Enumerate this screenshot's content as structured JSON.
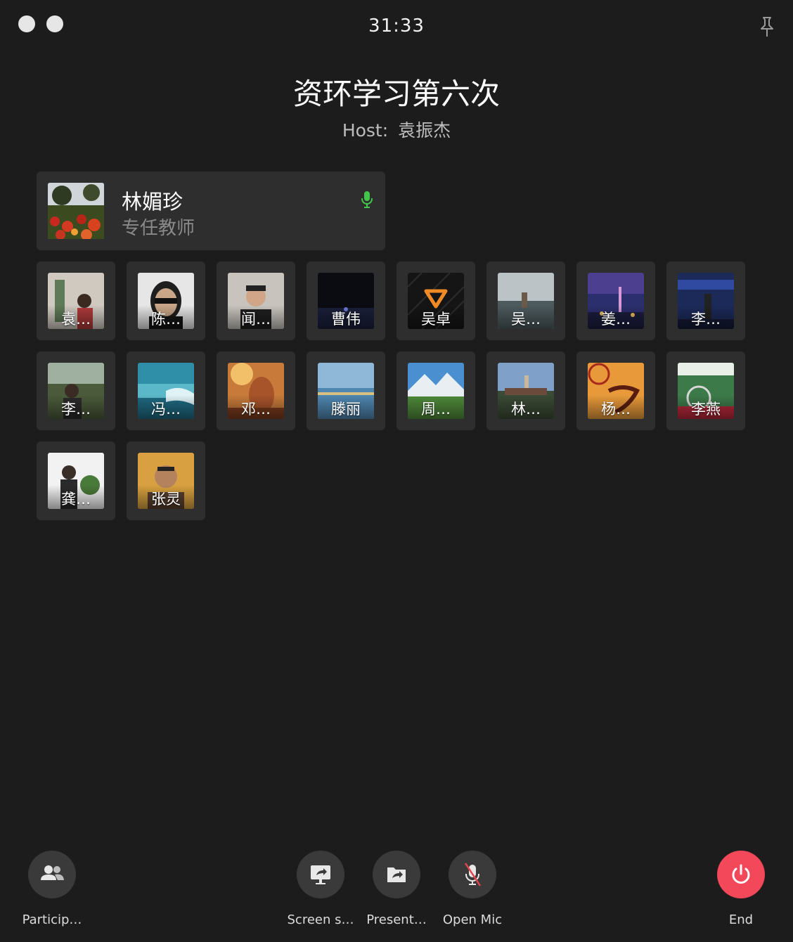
{
  "window": {
    "timer": "31:33"
  },
  "meeting": {
    "title": "资环学习第六次",
    "host_label": "Host:",
    "host_name": "袁振杰"
  },
  "speaker": {
    "name": "林媚珍",
    "role": "专任教师",
    "mic_color": "#43c74b"
  },
  "participants": [
    {
      "label": "袁…"
    },
    {
      "label": "陈…"
    },
    {
      "label": "闻…"
    },
    {
      "label": "曹伟"
    },
    {
      "label": "吴卓"
    },
    {
      "label": "吴…"
    },
    {
      "label": "姜…"
    },
    {
      "label": "李…"
    },
    {
      "label": "李…"
    },
    {
      "label": "冯…"
    },
    {
      "label": "邓…"
    },
    {
      "label": "滕丽"
    },
    {
      "label": "周…"
    },
    {
      "label": "林…"
    },
    {
      "label": "杨…"
    },
    {
      "label": "李燕"
    },
    {
      "label": "龚…"
    },
    {
      "label": "张灵"
    }
  ],
  "controls": {
    "participants": "Particip…",
    "screen_share": "Screen s…",
    "present": "Present…",
    "open_mic": "Open Mic",
    "end": "End"
  },
  "colors": {
    "background": "#1c1c1c",
    "tile": "#2e2e2e",
    "end": "#f2485a",
    "mic_active": "#43c74b",
    "mic_muted": "#e5454f"
  }
}
